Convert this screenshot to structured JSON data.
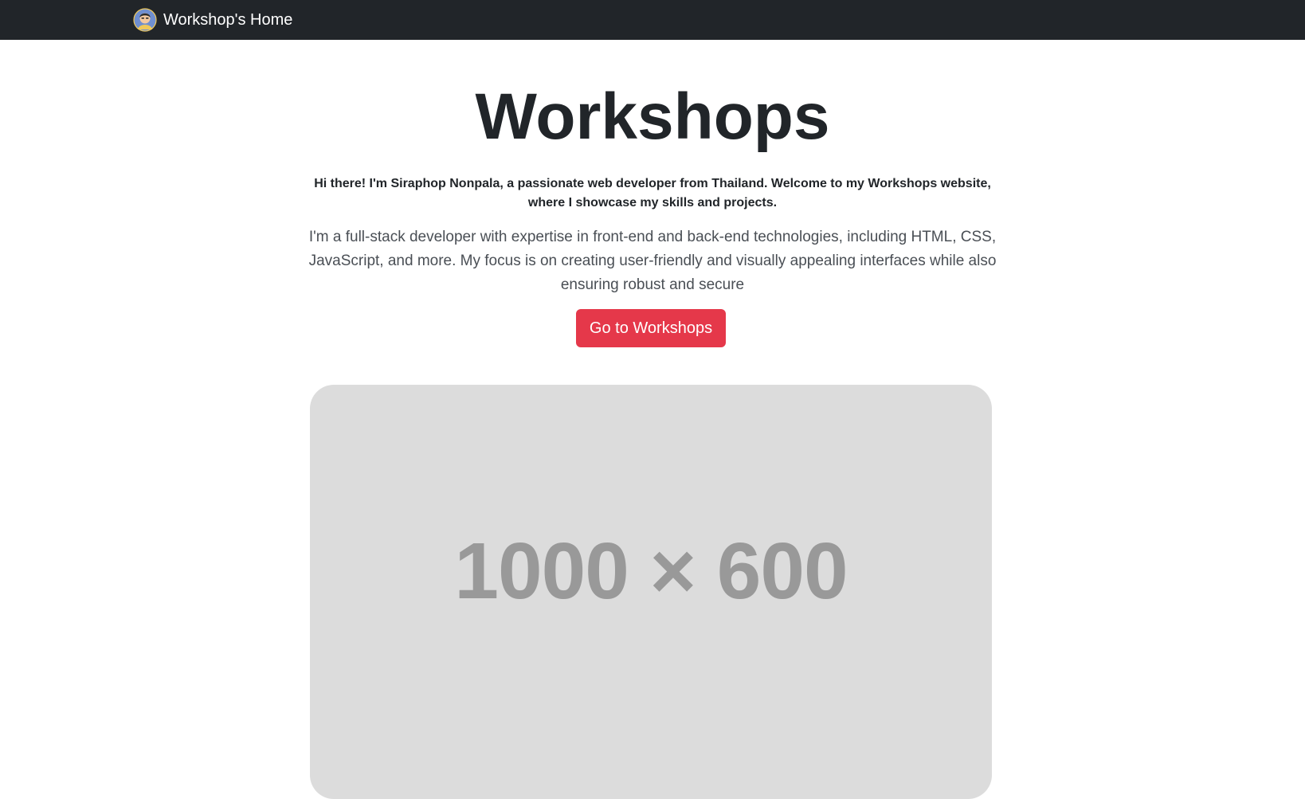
{
  "navbar": {
    "brand_label": "Workshop's Home",
    "logo_icon": "avatar-icon",
    "background": "#212529"
  },
  "hero": {
    "title": "Workshops",
    "intro": "Hi there! I'm Siraphop Nonpala, a passionate web developer from Thailand. Welcome to my Workshops website, where I showcase my skills and projects.",
    "description": "I'm a full-stack developer with expertise in front-end and back-end technologies, including HTML, CSS, JavaScript, and more. My focus is on creating user-friendly and visually appealing interfaces while also ensuring robust and secure",
    "cta_label": "Go to Workshops",
    "cta_color": "#e5384a"
  },
  "placeholder_image": {
    "label": "1000 × 600",
    "background": "#dcdcdc",
    "text_color": "#999999"
  }
}
